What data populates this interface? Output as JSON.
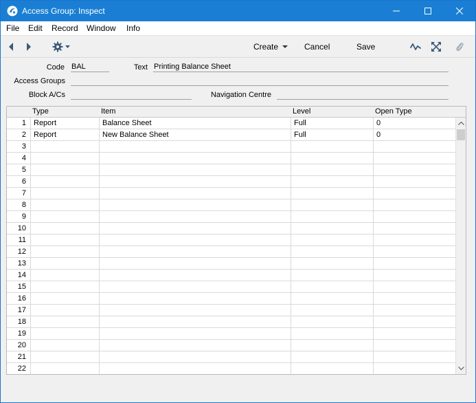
{
  "window": {
    "title": "Access Group: Inspect",
    "titlebar_color": "#1a7fd4"
  },
  "menu": {
    "items": [
      "File",
      "Edit",
      "Record",
      "Window",
      "Info"
    ]
  },
  "toolbar": {
    "create_label": "Create",
    "cancel_label": "Cancel",
    "save_label": "Save"
  },
  "form": {
    "code_label": "Code",
    "code_value": "BAL",
    "text_label": "Text",
    "text_value": "Printing Balance Sheet",
    "access_groups_label": "Access Groups",
    "access_groups_value": "",
    "block_acs_label": "Block A/Cs",
    "block_acs_value": "",
    "navigation_centre_label": "Navigation Centre",
    "navigation_centre_value": ""
  },
  "grid": {
    "headers": [
      "Type",
      "Item",
      "Level",
      "Open Type"
    ],
    "rows": [
      {
        "num": "1",
        "type": "Report",
        "item": "Balance Sheet",
        "level": "Full",
        "open": "0"
      },
      {
        "num": "2",
        "type": "Report",
        "item": "New Balance Sheet",
        "level": "Full",
        "open": "0"
      },
      {
        "num": "3",
        "type": "",
        "item": "",
        "level": "",
        "open": ""
      },
      {
        "num": "4",
        "type": "",
        "item": "",
        "level": "",
        "open": ""
      },
      {
        "num": "5",
        "type": "",
        "item": "",
        "level": "",
        "open": ""
      },
      {
        "num": "6",
        "type": "",
        "item": "",
        "level": "",
        "open": ""
      },
      {
        "num": "7",
        "type": "",
        "item": "",
        "level": "",
        "open": ""
      },
      {
        "num": "8",
        "type": "",
        "item": "",
        "level": "",
        "open": ""
      },
      {
        "num": "9",
        "type": "",
        "item": "",
        "level": "",
        "open": ""
      },
      {
        "num": "10",
        "type": "",
        "item": "",
        "level": "",
        "open": ""
      },
      {
        "num": "11",
        "type": "",
        "item": "",
        "level": "",
        "open": ""
      },
      {
        "num": "12",
        "type": "",
        "item": "",
        "level": "",
        "open": ""
      },
      {
        "num": "13",
        "type": "",
        "item": "",
        "level": "",
        "open": ""
      },
      {
        "num": "14",
        "type": "",
        "item": "",
        "level": "",
        "open": ""
      },
      {
        "num": "15",
        "type": "",
        "item": "",
        "level": "",
        "open": ""
      },
      {
        "num": "16",
        "type": "",
        "item": "",
        "level": "",
        "open": ""
      },
      {
        "num": "17",
        "type": "",
        "item": "",
        "level": "",
        "open": ""
      },
      {
        "num": "18",
        "type": "",
        "item": "",
        "level": "",
        "open": ""
      },
      {
        "num": "19",
        "type": "",
        "item": "",
        "level": "",
        "open": ""
      },
      {
        "num": "20",
        "type": "",
        "item": "",
        "level": "",
        "open": ""
      },
      {
        "num": "21",
        "type": "",
        "item": "",
        "level": "",
        "open": ""
      },
      {
        "num": "22",
        "type": "",
        "item": "",
        "level": "",
        "open": ""
      }
    ]
  },
  "icons": {
    "app": "app-logo-icon",
    "back": "back-arrow-icon",
    "forward": "forward-arrow-icon",
    "settings": "gear-icon",
    "activity": "activity-icon",
    "expand": "expand-icon",
    "attach": "paperclip-icon"
  }
}
